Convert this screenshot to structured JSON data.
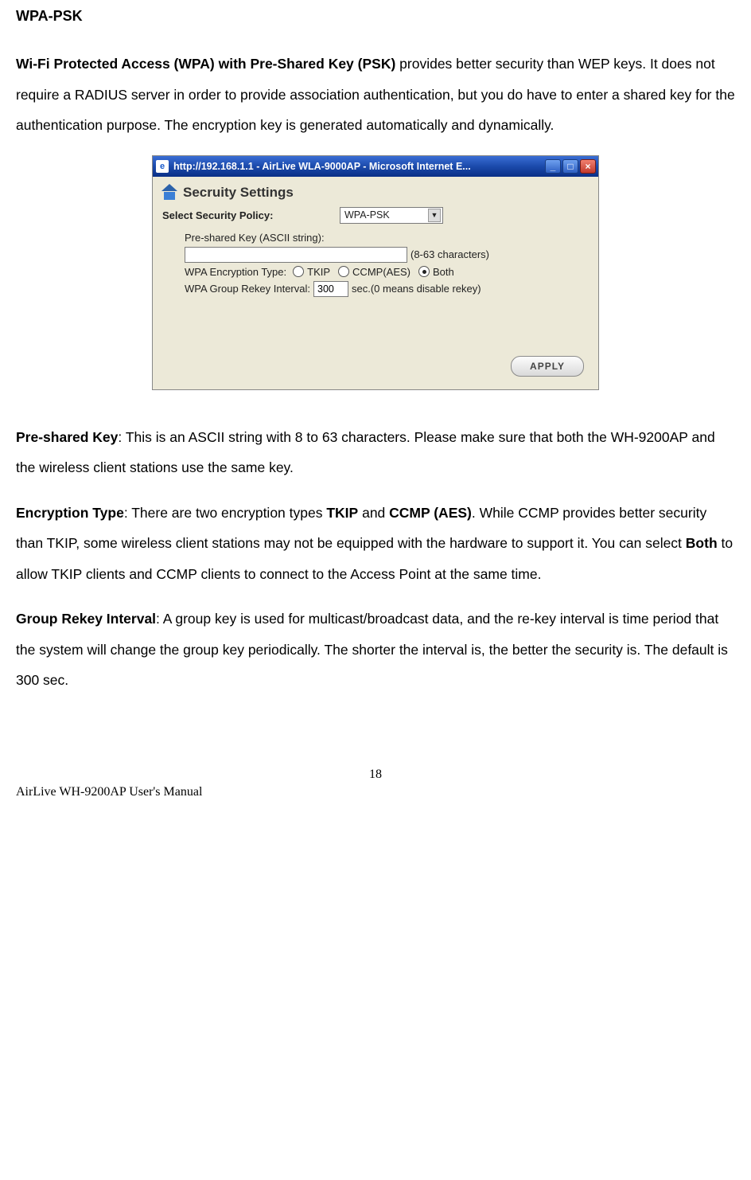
{
  "doc": {
    "title": "WPA-PSK",
    "intro_bold": "Wi-Fi Protected Access (WPA) with Pre-Shared Key (PSK)",
    "intro_rest": " provides better security than WEP keys. It does not require a RADIUS server in order to provide association authentication, but you do have to enter a shared key for the authentication purpose. The encryption key is generated automatically and dynamically.",
    "psk_bold": "Pre-shared Key",
    "psk_rest": ": This is an ASCII string with 8 to 63 characters. Please make sure that both the WH-9200AP and the wireless client stations use the same key.",
    "enc_bold": "Encryption Type",
    "enc_mid1": ": There are two encryption types ",
    "enc_tkip": "TKIP",
    "enc_mid2": " and ",
    "enc_ccmp": "CCMP (AES)",
    "enc_mid3": ". While CCMP provides better security than TKIP, some wireless client stations may not be equipped with the hardware to support it. You can select ",
    "enc_both": "Both",
    "enc_mid4": " to allow TKIP clients and CCMP clients to connect to the Access Point at the same time.",
    "grp_bold": "Group Rekey Interval",
    "grp_rest": ": A group key is used for multicast/broadcast data, and the re-key interval is time period that the system will change the group key periodically. The shorter the interval is, the better the security is. The default is 300 sec.",
    "page_number": "18",
    "manual_name": "AirLive WH-9200AP User's Manual"
  },
  "dialog": {
    "title_text": "http://192.168.1.1 - AirLive WLA-9000AP - Microsoft Internet E...",
    "heading": "Secruity Settings",
    "select_label": "Select Security Policy:",
    "select_value": "WPA-PSK",
    "psk_label": "Pre-shared Key (ASCII string):",
    "psk_value": "",
    "psk_hint": "(8-63 characters)",
    "enc_label": "WPA Encryption Type:",
    "enc_opt_tkip": "TKIP",
    "enc_opt_ccmp": "CCMP(AES)",
    "enc_opt_both": "Both",
    "enc_selected": "Both",
    "rekey_label": "WPA Group Rekey Interval:",
    "rekey_value": "300",
    "rekey_hint": "sec.(0 means disable rekey)",
    "apply_label": "APPLY",
    "ie_icon_char": "e"
  }
}
